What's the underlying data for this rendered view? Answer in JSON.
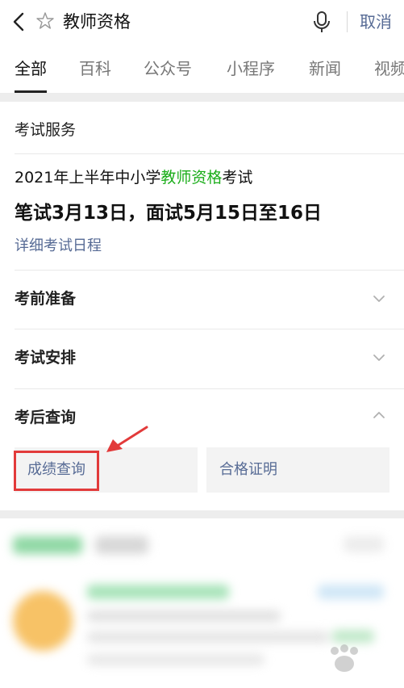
{
  "search": {
    "query": "教师资格",
    "cancel_label": "取消"
  },
  "tabs": [
    "全部",
    "百科",
    "公众号",
    "小程序",
    "新闻",
    "视频"
  ],
  "exam_card": {
    "title": "考试服务",
    "exam_prefix": "2021年上半年中小学",
    "exam_highlight": "教师资格",
    "exam_suffix": "考试",
    "dates": "笔试3月13日，面试5月15日至16日",
    "detail_link": "详细考试日程",
    "sections": [
      {
        "label": "考前准备",
        "expanded": false
      },
      {
        "label": "考试安排",
        "expanded": false
      },
      {
        "label": "考后查询",
        "expanded": true
      }
    ],
    "query_buttons": [
      "成绩查询",
      "合格证明"
    ]
  },
  "icons": {
    "back": "chevron-left-icon",
    "star": "star-outline-icon",
    "mic": "microphone-icon",
    "chevron_down": "chevron-down-icon",
    "chevron_up": "chevron-up-icon",
    "annotation_arrow": "red-arrow-icon"
  },
  "colors": {
    "link": "#576b95",
    "highlight_green": "#1aad19",
    "annotation_red": "#e23a3a"
  }
}
